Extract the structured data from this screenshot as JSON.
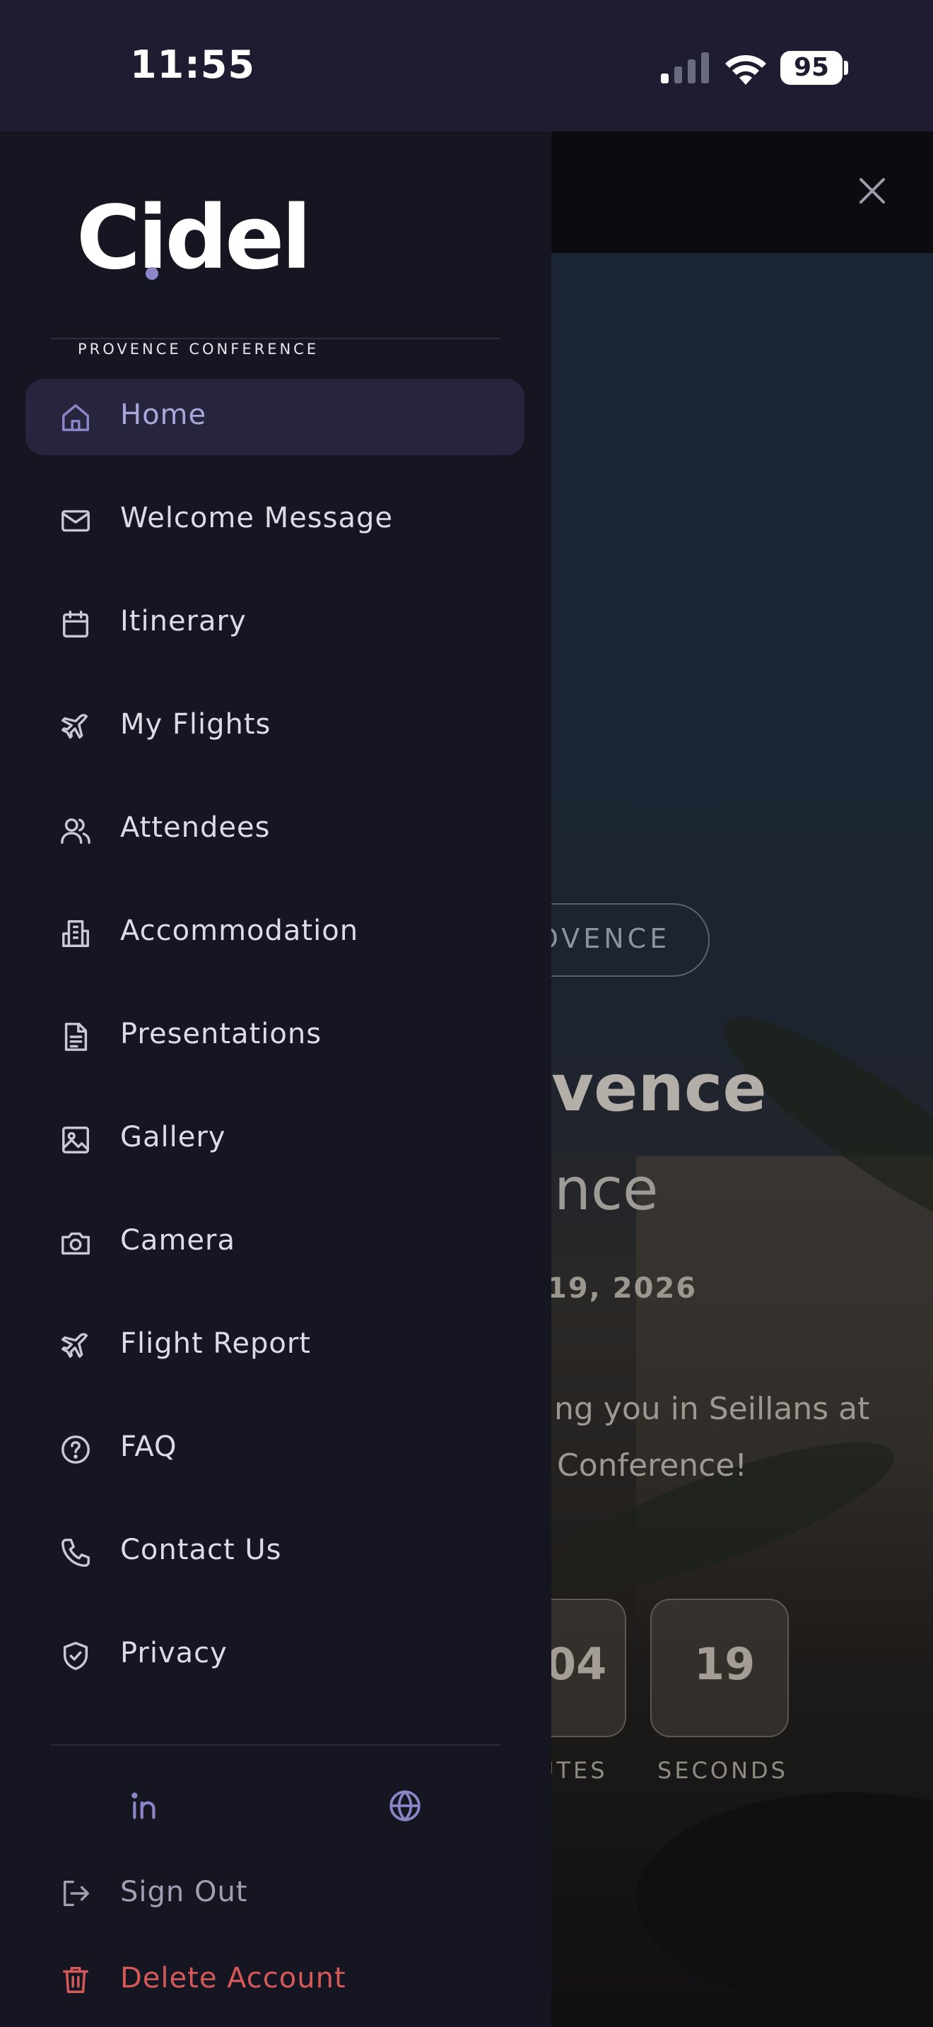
{
  "status_bar": {
    "time": "11:55",
    "battery": "95"
  },
  "drawer": {
    "logo": {
      "word": "Cidel",
      "subtitle": "PROVENCE CONFERENCE"
    },
    "nav": [
      {
        "label": "Home",
        "icon": "home-icon",
        "active": true
      },
      {
        "label": "Welcome Message",
        "icon": "mail-icon"
      },
      {
        "label": "Itinerary",
        "icon": "calendar-icon"
      },
      {
        "label": "My Flights",
        "icon": "plane-icon"
      },
      {
        "label": "Attendees",
        "icon": "users-icon"
      },
      {
        "label": "Accommodation",
        "icon": "building-icon"
      },
      {
        "label": "Presentations",
        "icon": "document-icon"
      },
      {
        "label": "Gallery",
        "icon": "image-icon"
      },
      {
        "label": "Camera",
        "icon": "camera-icon"
      },
      {
        "label": "Flight Report",
        "icon": "plane-icon"
      },
      {
        "label": "FAQ",
        "icon": "help-circle-icon"
      },
      {
        "label": "Contact Us",
        "icon": "phone-icon"
      },
      {
        "label": "Privacy",
        "icon": "shield-check-icon"
      }
    ],
    "social": [
      {
        "icon": "linkedin-icon"
      },
      {
        "icon": "globe-icon"
      }
    ],
    "sign_out": "Sign Out",
    "delete_account": "Delete Account",
    "colors": {
      "drawer_bg": "#161622",
      "active_bg": "#27253e",
      "accent": "#8b86c8",
      "danger": "#d45a5a"
    }
  },
  "background_page": {
    "pill_text": "OVENCE",
    "title_fragment": "vence",
    "subtitle_fragment": "nce",
    "date_fragment": "19, 2026",
    "message_line1": "ng you in Seillans at",
    "message_line2": "Conference!",
    "countdown": [
      {
        "value": "04",
        "label": "UTES"
      },
      {
        "value": "19",
        "label": "SECONDS"
      }
    ]
  }
}
